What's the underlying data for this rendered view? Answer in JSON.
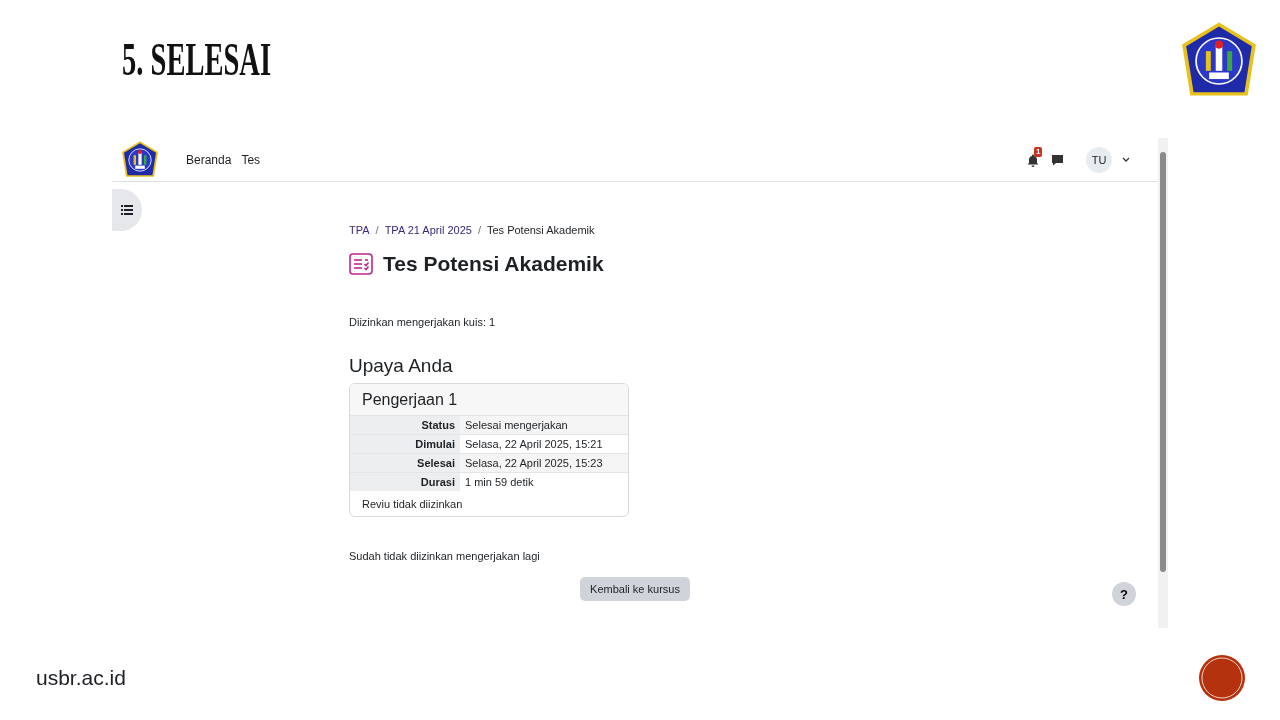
{
  "slide": {
    "title": "5. SELESAI",
    "footer": "usbr.ac.id"
  },
  "navbar": {
    "links": [
      "Beranda",
      "Tes"
    ],
    "notification_count": "1",
    "avatar": "TU"
  },
  "breadcrumb": [
    {
      "kind": "link",
      "text": "TPA"
    },
    {
      "kind": "separator",
      "text": "/"
    },
    {
      "kind": "link",
      "text": "TPA 21 April 2025"
    },
    {
      "kind": "separator",
      "text": "/"
    },
    {
      "kind": "current",
      "text": "Tes Potensi Akademik"
    }
  ],
  "heading": "Tes Potensi Akademik",
  "attempts_allowed": "Diizinkan mengerjakan kuis: 1",
  "section_title": "Upaya Anda",
  "attempt": {
    "title": "Pengerjaan 1",
    "rows": [
      {
        "label": "Status",
        "value": "Selesai mengerjakan"
      },
      {
        "label": "Dimulai",
        "value": "Selasa, 22 April 2025, 15:21"
      },
      {
        "label": "Selesai",
        "value": "Selasa, 22 April 2025, 15:23"
      },
      {
        "label": "Durasi",
        "value": "1 min 59 detik"
      }
    ],
    "footer": "Reviu tidak diizinkan"
  },
  "message": "Sudah tidak diizinkan mengerjakan lagi",
  "button": "Kembali ke kursus",
  "help": "?"
}
